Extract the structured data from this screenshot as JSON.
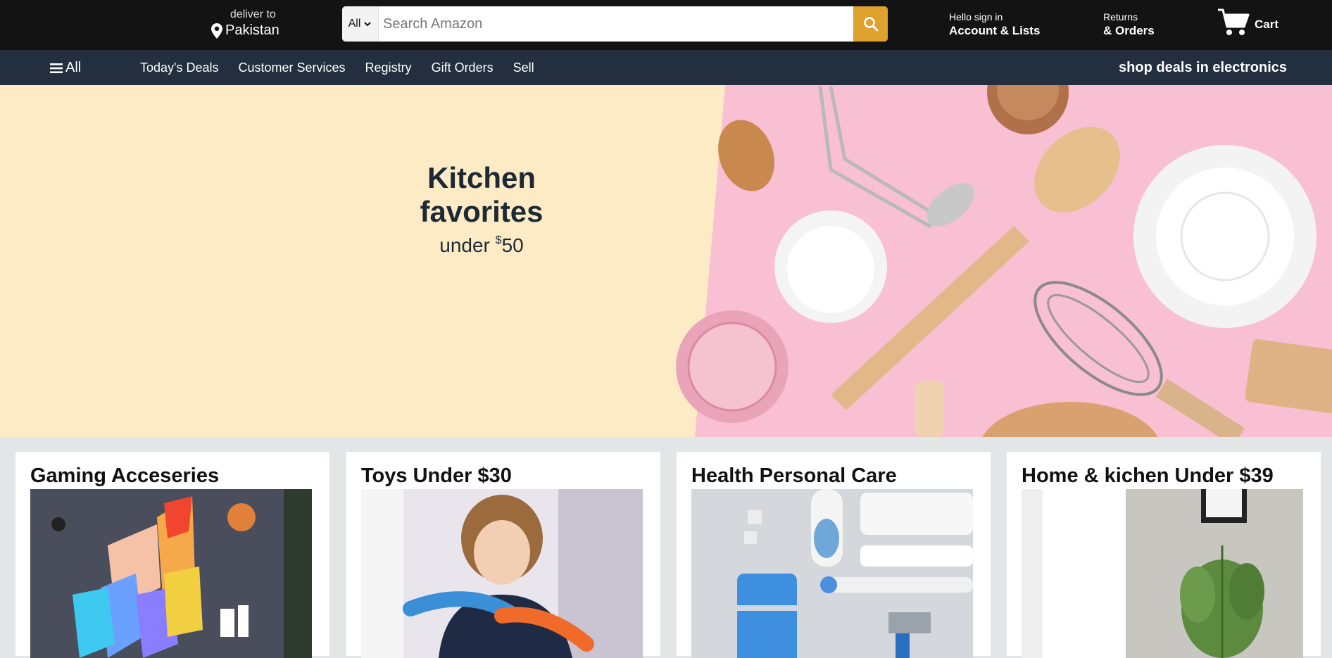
{
  "header": {
    "deliver_label": "deliver to",
    "deliver_country": "Pakistan",
    "search": {
      "category": "All",
      "placeholder": "Search Amazon"
    },
    "account": {
      "line1": "Hello sign in",
      "line2": "Account & Lists"
    },
    "returns": {
      "line1": "Returns",
      "line2": "& Orders"
    },
    "cart_label": "Cart"
  },
  "subnav": {
    "all_label": "All",
    "links": [
      "Today's Deals",
      "Customer Services",
      "Registry",
      "Gift Orders",
      "Sell"
    ],
    "promo": "shop deals in electronics"
  },
  "hero": {
    "title": "Kitchen favorites",
    "sub_prefix": "under ",
    "sub_currency": "$",
    "sub_amount": "50"
  },
  "cards": [
    {
      "title": "Gaming Acceseries"
    },
    {
      "title": "Toys Under $30"
    },
    {
      "title": "Health Personal Care"
    },
    {
      "title": "Home & kichen Under $39"
    }
  ],
  "colors": {
    "header_bg": "#131313",
    "subnav_bg": "#232f3e",
    "search_button": "#e0a22e",
    "hero_bg": "#fdebc6",
    "hero_pink": "#f9bfd2"
  }
}
